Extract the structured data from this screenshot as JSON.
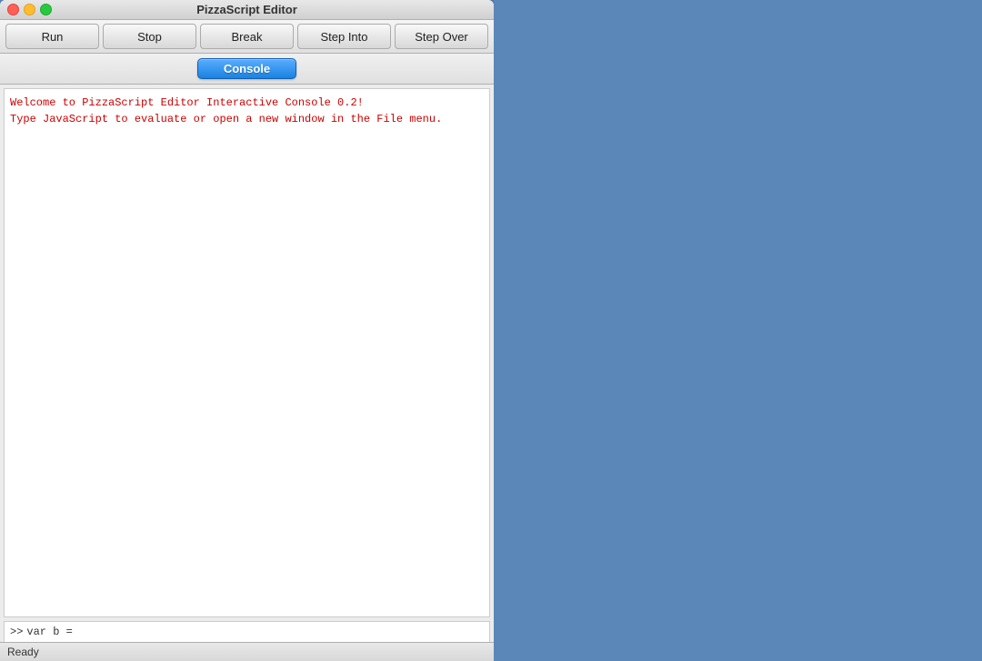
{
  "window": {
    "title": "PizzaScript Editor"
  },
  "toolbar": {
    "run_label": "Run",
    "stop_label": "Stop",
    "break_label": "Break",
    "step_into_label": "Step Into",
    "step_over_label": "Step Over"
  },
  "console": {
    "button_label": "Console",
    "welcome_line1": "Welcome to PizzaScript Editor Interactive Console 0.2!",
    "welcome_line2": "Type JavaScript to evaluate or open a new window in the File menu."
  },
  "input": {
    "prompt": ">>",
    "value": "var b ="
  },
  "status": {
    "text": "Ready"
  }
}
